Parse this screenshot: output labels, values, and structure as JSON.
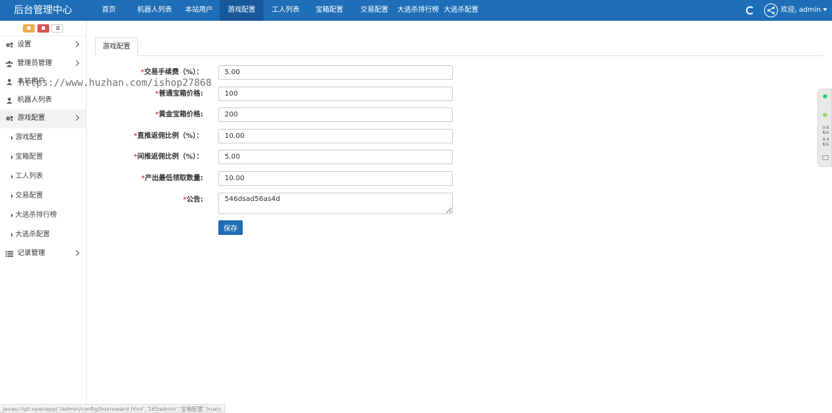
{
  "brand": "后台管理中心",
  "nav": [
    {
      "label": "首页"
    },
    {
      "label": "机器人列表"
    },
    {
      "label": "本站用户"
    },
    {
      "label": "游戏配置",
      "active": true
    },
    {
      "label": "工人列表"
    },
    {
      "label": "宝箱配置"
    },
    {
      "label": "交易配置"
    },
    {
      "label": "大逃杀排行榜"
    },
    {
      "label": "大逃杀配置"
    }
  ],
  "user": {
    "welcome": "欢迎, admin"
  },
  "sidebar": {
    "items": [
      {
        "label": "设置",
        "icon": "gears-icon",
        "has_children": true
      },
      {
        "label": "管理员管理",
        "icon": "users-icon",
        "has_children": true
      },
      {
        "label": "本站用户",
        "icon": "user-icon",
        "has_children": false
      },
      {
        "label": "机器人列表",
        "icon": "user-icon",
        "has_children": false
      },
      {
        "label": "游戏配置",
        "icon": "gears-icon",
        "has_children": true,
        "active": true
      }
    ],
    "subitems": [
      {
        "label": "游戏配置"
      },
      {
        "label": "宝箱配置"
      },
      {
        "label": "工人列表"
      },
      {
        "label": "交易配置"
      },
      {
        "label": "大逃杀排行榜"
      },
      {
        "label": "大逃杀配置"
      }
    ],
    "last_item": {
      "label": "记录管理",
      "icon": "list-icon",
      "has_children": true
    }
  },
  "tab": {
    "label": "游戏配置"
  },
  "form": {
    "fields": [
      {
        "label": "交易手续费（%）：",
        "value": "5.00"
      },
      {
        "label": "普通宝箱价格:",
        "value": "100"
      },
      {
        "label": "黄金宝箱价格:",
        "value": "200"
      },
      {
        "label": "直推返佣比例（%）：",
        "value": "10.00"
      },
      {
        "label": "间推返佣比例（%）：",
        "value": "5.00"
      },
      {
        "label": "产出最低领取数量:",
        "value": "10.00"
      }
    ],
    "notice": {
      "label": "公告:",
      "value": "546dsad56as4d"
    },
    "required_mark": "*",
    "save_label": "保存"
  },
  "watermark": "https://www.huzhan.com/ishop27868",
  "widget": {
    "line1": "0.6",
    "unit1": "K/s",
    "line2": "4.4",
    "unit2": "K/s"
  },
  "statusbar": "javascript:openapp('/admin/config/boxreward.html','165admin','宝箱配置',true);",
  "colors": {
    "primary": "#1e6fb8",
    "required": "#d9534f",
    "home_btn": "#f0ad4e",
    "trash_btn": "#d9534f"
  }
}
